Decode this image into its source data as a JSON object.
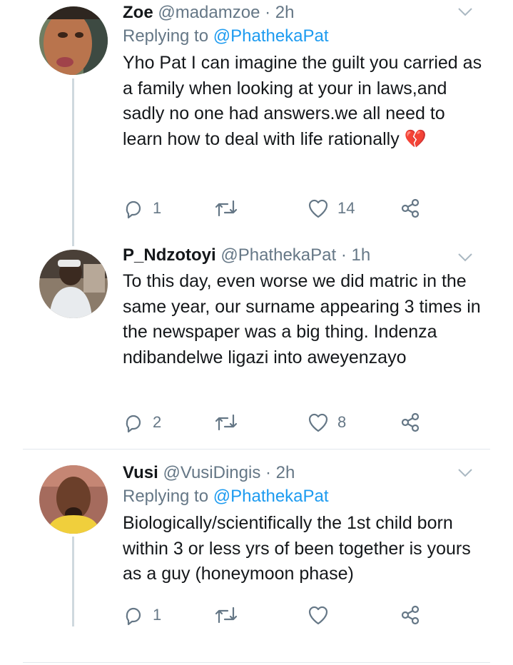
{
  "tweets": [
    {
      "name": "Zoe",
      "handle": "@madamzoe",
      "time": "· 2h",
      "reply_prefix": "Replying to",
      "reply_to": "@PhathekaPat",
      "text": "Yho Pat I can imagine the guilt you carried as a family when looking at your in laws,and sadly no one had answers.we all need to learn how to deal with life rationally 💔",
      "replies": "1",
      "retweets": "",
      "likes": "14"
    },
    {
      "name": "P_Ndzotoyi",
      "handle": "@PhathekaPat",
      "time": "· 1h",
      "text": "To this day, even worse we did matric in the same year, our surname appearing 3 times in the newspaper was a big thing. Indenza ndibandelwe ligazi into aweyenzayo",
      "replies": "2",
      "retweets": "",
      "likes": "8"
    },
    {
      "name": "Vusi",
      "handle": "@VusiDingis",
      "time": "· 2h",
      "reply_prefix": "Replying to",
      "reply_to": "@PhathekaPat",
      "text": "Biologically/scientifically the 1st child born within 3 or less yrs of been together is yours as a guy (honeymoon phase)",
      "replies": "1",
      "retweets": "",
      "likes": ""
    }
  ],
  "icons": {
    "reply": "reply-icon",
    "retweet": "retweet-icon",
    "like": "heart-icon",
    "share": "share-icon",
    "more": "chevron-down-icon"
  },
  "colors": {
    "text": "#14171a",
    "muted": "#657786",
    "link": "#1d9bf0",
    "thread_line": "#cfd9de"
  }
}
